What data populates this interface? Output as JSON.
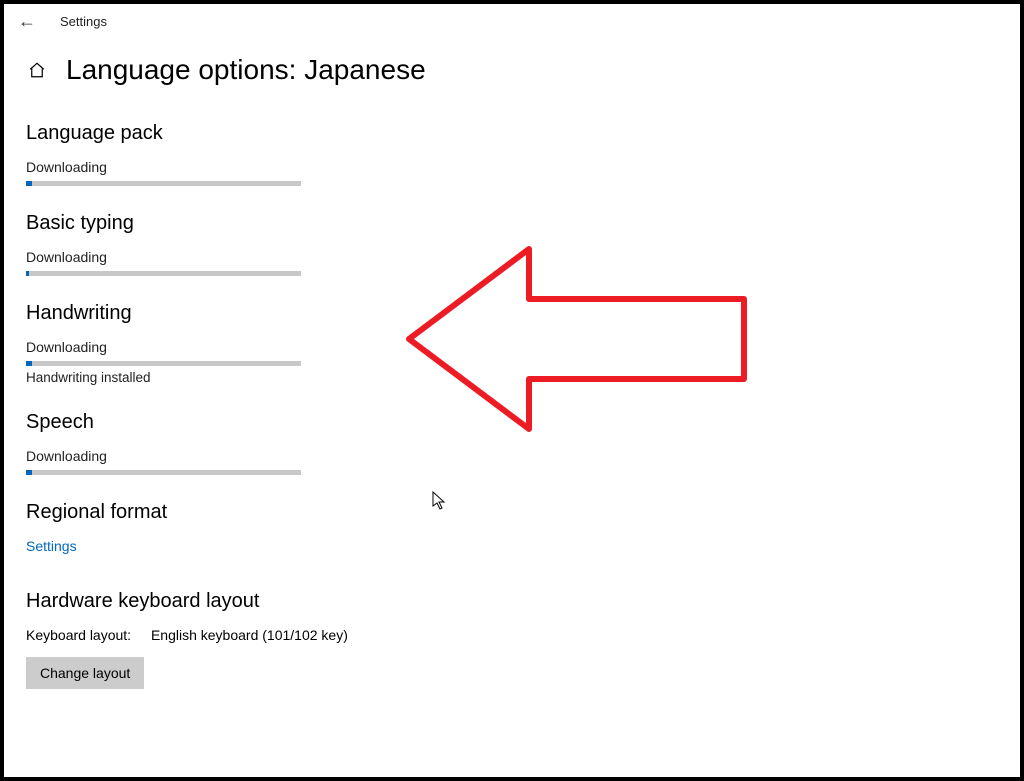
{
  "app": {
    "title": "Settings"
  },
  "page": {
    "title": "Language options: Japanese"
  },
  "sections": {
    "language_pack": {
      "title": "Language pack",
      "status": "Downloading",
      "progress_percent": 2
    },
    "basic_typing": {
      "title": "Basic typing",
      "status": "Downloading",
      "progress_percent": 1
    },
    "handwriting": {
      "title": "Handwriting",
      "status": "Downloading",
      "progress_percent": 2,
      "installed_text": "Handwriting installed"
    },
    "speech": {
      "title": "Speech",
      "status": "Downloading",
      "progress_percent": 2
    },
    "regional_format": {
      "title": "Regional format",
      "link_label": "Settings"
    },
    "hardware_keyboard": {
      "title": "Hardware keyboard layout",
      "label": "Keyboard layout:",
      "value": "English keyboard (101/102 key)",
      "button_label": "Change layout"
    }
  },
  "colors": {
    "accent": "#0067c0",
    "progress_bg": "#c8c8c8",
    "annotation": "#ed1c24"
  }
}
